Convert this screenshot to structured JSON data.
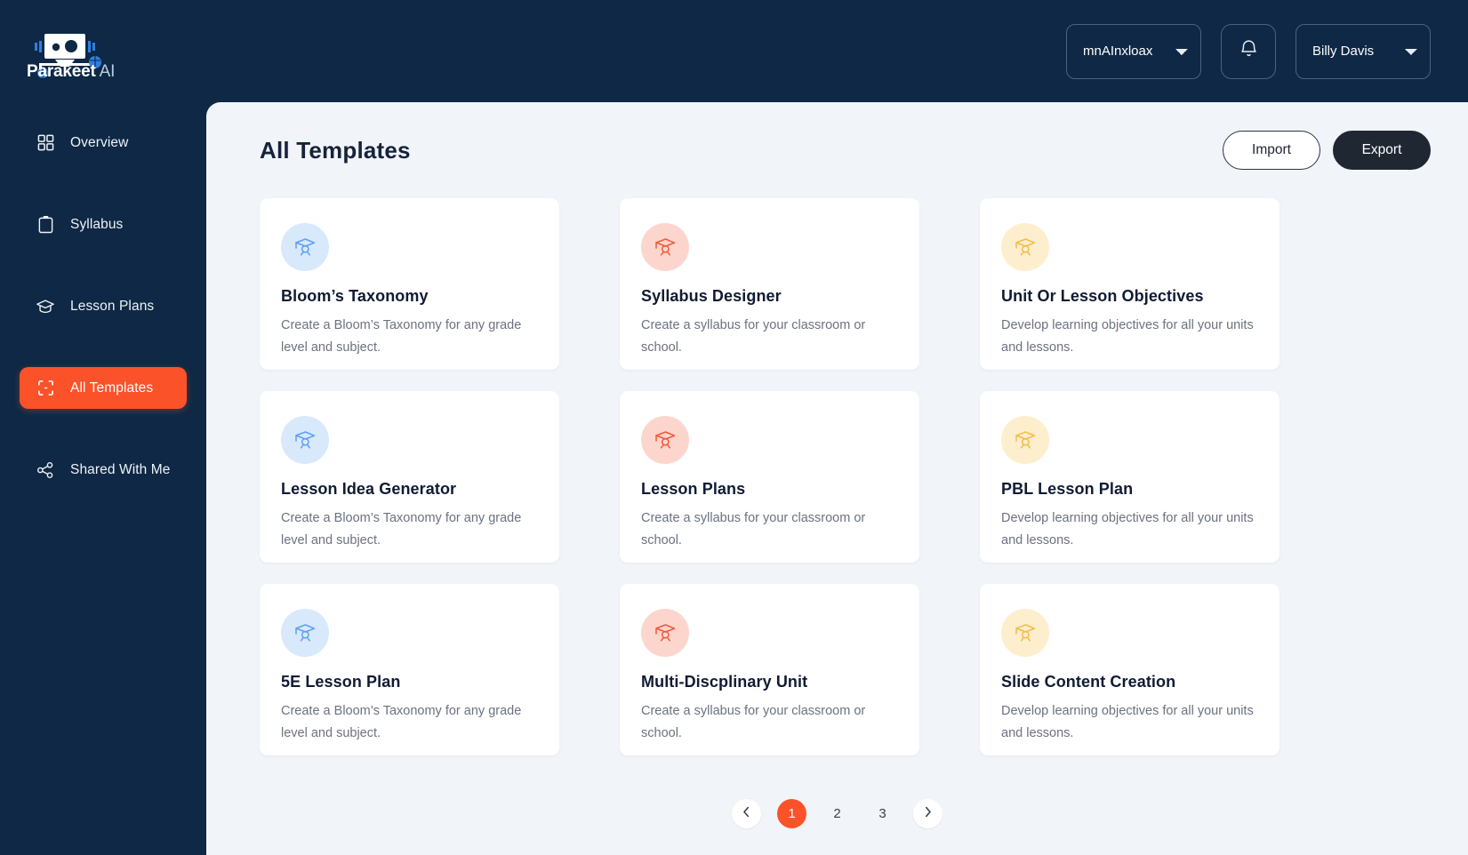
{
  "brand": {
    "name_bold": "Parakeet",
    "name_light": "AI",
    "logo_icon": "robot-head-icon"
  },
  "topbar": {
    "menu_icon": "hamburger-menu-icon",
    "org_select": {
      "value": "mnAInxloax",
      "options": [
        "mnAInxloax"
      ],
      "icon": "chevron-down-icon"
    },
    "notifications_icon": "bell-icon",
    "user_select": {
      "value": "Billy Davis",
      "options": [
        "Billy Davis"
      ],
      "icon": "chevron-down-icon"
    }
  },
  "sidebar": {
    "items": [
      {
        "label": "Overview",
        "icon": "grid-icon",
        "active": false
      },
      {
        "label": "Syllabus",
        "icon": "clipboard-icon",
        "active": false
      },
      {
        "label": "Lesson Plans",
        "icon": "graduation-cap-icon",
        "active": false
      },
      {
        "label": "All Templates",
        "icon": "frame-icon",
        "active": true
      },
      {
        "label": "Shared With Me",
        "icon": "share-icon",
        "active": false
      }
    ],
    "active_color": "#fb5229"
  },
  "main": {
    "title": "All Templates",
    "import_label": "Import",
    "export_label": "Export"
  },
  "cards": [
    {
      "title": "Bloom’s Taxonomy",
      "desc": "Create a Bloom’s Taxonomy for any grade level and subject.",
      "icon": "graduation-cap-icon",
      "tone": "blue"
    },
    {
      "title": "Syllabus Designer",
      "desc": "Create a syllabus for your classroom or school.",
      "icon": "graduation-cap-icon",
      "tone": "red"
    },
    {
      "title": "Unit Or Lesson Objectives",
      "desc": "Develop learning objectives for all your units and lessons.",
      "icon": "graduation-cap-icon",
      "tone": "yellow"
    },
    {
      "title": "Lesson Idea Generator",
      "desc": "Create a Bloom’s Taxonomy for any grade level and subject.",
      "icon": "graduation-cap-icon",
      "tone": "blue"
    },
    {
      "title": "Lesson Plans",
      "desc": "Create a syllabus for your classroom or school.",
      "icon": "graduation-cap-icon",
      "tone": "red"
    },
    {
      "title": "PBL Lesson Plan",
      "desc": "Develop learning objectives for all your units and lessons.",
      "icon": "graduation-cap-icon",
      "tone": "yellow"
    },
    {
      "title": "5E Lesson Plan",
      "desc": "Create a Bloom’s Taxonomy for any grade level and subject.",
      "icon": "graduation-cap-icon",
      "tone": "blue"
    },
    {
      "title": "Multi-Discplinary Unit",
      "desc": "Create a syllabus for your classroom or school.",
      "icon": "graduation-cap-icon",
      "tone": "red"
    },
    {
      "title": "Slide Content Creation",
      "desc": "Develop learning objectives for all your units and lessons.",
      "icon": "graduation-cap-icon",
      "tone": "yellow"
    }
  ],
  "pagination": {
    "prev_icon": "chevron-left-icon",
    "next_icon": "chevron-right-icon",
    "pages": [
      "1",
      "2",
      "3"
    ],
    "current": "1",
    "active_color": "#fb5229"
  },
  "colors": {
    "sidebar_bg": "#0e2845",
    "panel_bg": "#f1f4f9",
    "accent": "#fb5229",
    "card_bg": "#ffffff",
    "icon_blue": "#5ba0f2",
    "icon_red": "#f2573a",
    "icon_yellow": "#f6bb4a"
  }
}
